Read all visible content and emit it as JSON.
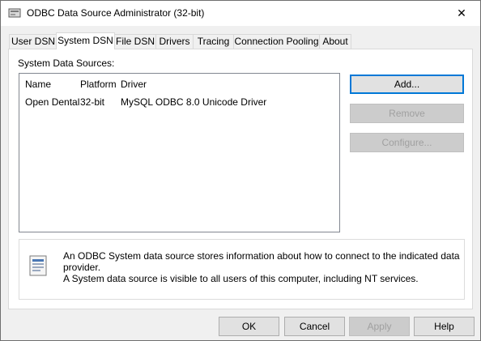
{
  "window": {
    "title": "ODBC Data Source Administrator (32-bit)",
    "close_glyph": "✕"
  },
  "tabs": [
    {
      "label": "User DSN",
      "active": false
    },
    {
      "label": "System DSN",
      "active": true
    },
    {
      "label": "File DSN",
      "active": false
    },
    {
      "label": "Drivers",
      "active": false
    },
    {
      "label": "Tracing",
      "active": false
    },
    {
      "label": "Connection Pooling",
      "active": false
    },
    {
      "label": "About",
      "active": false
    }
  ],
  "system_dsn": {
    "section_label": "System Data Sources:",
    "columns": [
      "Name",
      "Platform",
      "Driver"
    ],
    "rows": [
      {
        "name": "Open Dental",
        "platform": "32-bit",
        "driver": "MySQL ODBC 8.0 Unicode Driver"
      }
    ],
    "buttons": {
      "add": "Add...",
      "remove": "Remove",
      "configure": "Configure..."
    },
    "info_text": [
      "An ODBC System data source stores information about how to connect to the indicated data provider.",
      "A System data source is visible to all users of this computer, including NT services."
    ]
  },
  "footer": {
    "ok": "OK",
    "cancel": "Cancel",
    "apply": "Apply",
    "help": "Help"
  },
  "icons": {
    "title": "odbc-app-icon",
    "info": "data-source-info-icon",
    "close": "close-icon"
  },
  "colors": {
    "default_button_border": "#0078d7",
    "disabled_text": "#a0a0a0"
  }
}
